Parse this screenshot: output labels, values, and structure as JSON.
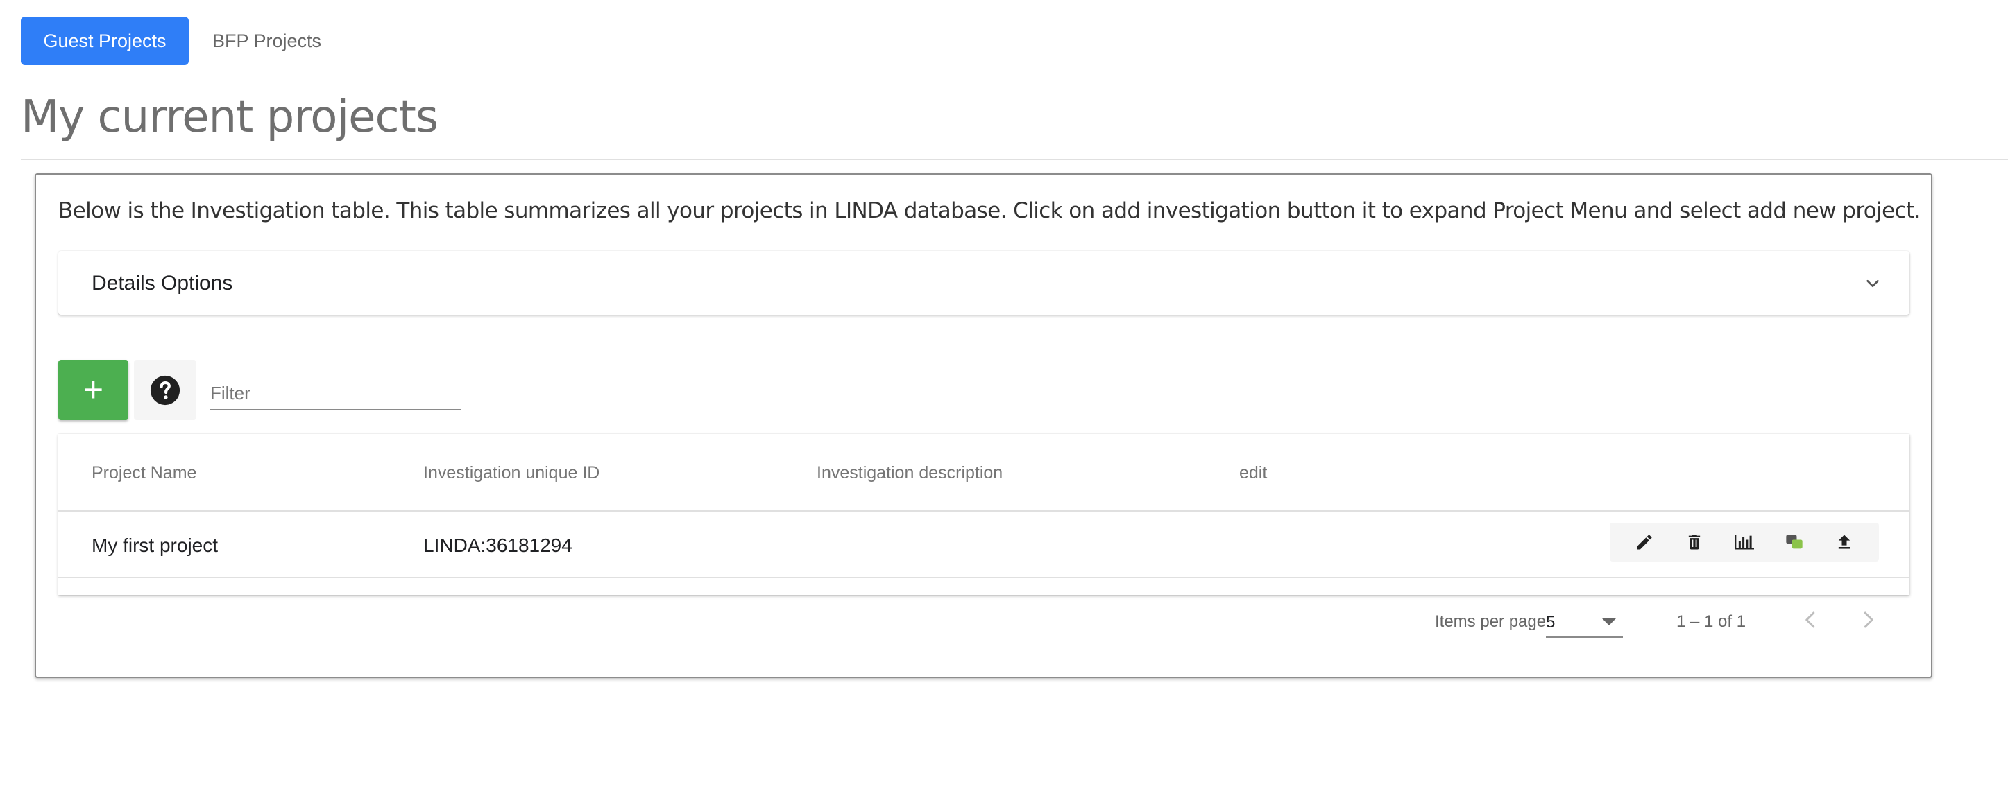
{
  "tabs": [
    {
      "label": "Guest Projects",
      "active": true
    },
    {
      "label": "BFP Projects",
      "active": false
    }
  ],
  "page": {
    "title": "My current projects"
  },
  "card": {
    "intro": "Below is the Investigation table. This table summarizes all your projects in LINDA database. Click on add investigation button it to expand Project Menu and select add new project.",
    "details": {
      "title": "Details Options",
      "icon": "chevron-down-icon"
    }
  },
  "toolbar": {
    "add_label": "+",
    "help_icon": "help-circle-icon",
    "filter_placeholder": "Filter"
  },
  "table": {
    "columns": [
      "Project Name",
      "Investigation unique ID",
      "Investigation description",
      "edit"
    ],
    "rows": [
      {
        "project_name": "My first project",
        "unique_id": "LINDA:36181294",
        "description": "",
        "actions": [
          "edit-pencil-icon",
          "delete-trash-icon",
          "bar-chart-icon",
          "share-bubbles-icon",
          "upload-icon"
        ]
      }
    ]
  },
  "paginator": {
    "items_per_page_label": "Items per page:",
    "items_per_page_value": "5",
    "range_label": "1 – 1 of 1"
  },
  "colors": {
    "primary_tab": "#2f7ef7",
    "add_button": "#4caf50",
    "share_icon_green": "#8bc34a"
  }
}
